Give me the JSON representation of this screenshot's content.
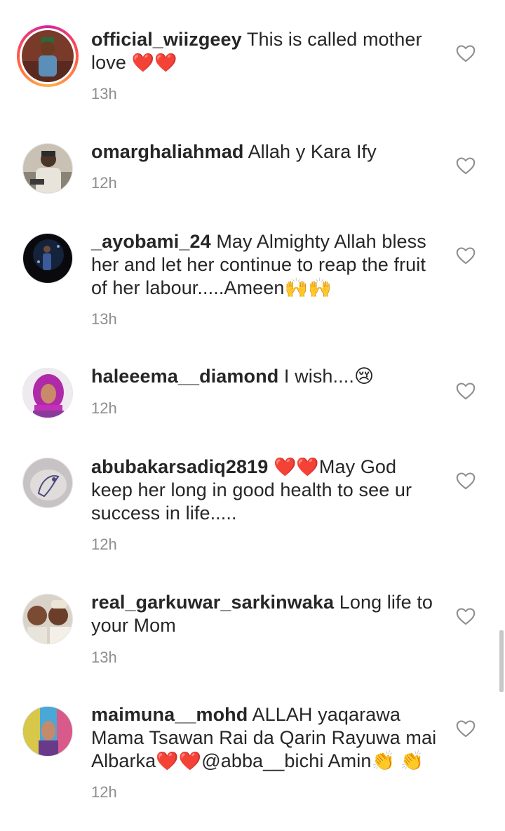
{
  "comments": [
    {
      "username": "official_wiizgeey",
      "text": "This is called mother love",
      "emojis": "❤️❤️",
      "time": "13h",
      "avatar": "avatar-photo"
    },
    {
      "username": "omarghaliahmad",
      "text": "Allah y Kara Ify",
      "emojis": "",
      "time": "12h",
      "avatar": "avatar-photo"
    },
    {
      "username": "_ayobami_24",
      "text": "May Almighty Allah bless her and let her continue to reap the fruit of her labour.....Ameen",
      "emojis": "🙌🙌",
      "time": "13h",
      "avatar": "avatar-photo"
    },
    {
      "username": "haleeema__diamond",
      "text": "I wish....",
      "emojis": "😢",
      "time": "12h",
      "avatar": "avatar-photo"
    },
    {
      "username": "abubakarsadiq2819",
      "text_pre_emoji": "❤️❤️",
      "text": "May God keep her long in good health to see ur success in life.....",
      "emojis": "",
      "time": "12h",
      "avatar": "avatar-photo"
    },
    {
      "username": "real_garkuwar_sarkinwaka",
      "text": "Long life to your Mom",
      "emojis": "",
      "time": "13h",
      "avatar": "avatar-photo"
    },
    {
      "username": "maimuna__mohd",
      "text": "ALLAH yaqarawa Mama Tsawan Rai da Qarin Rayuwa mai Albarka",
      "emojis_mid": "❤️❤️",
      "text_after": "@abba__bichi Amin",
      "emojis": "👏 👏",
      "time": "12h",
      "avatar": "avatar-photo"
    }
  ],
  "icons": {
    "like": "heart-outline-icon"
  },
  "colors": {
    "text": "#262626",
    "muted": "#8e8e8e",
    "heart": "#ed1c2e"
  }
}
